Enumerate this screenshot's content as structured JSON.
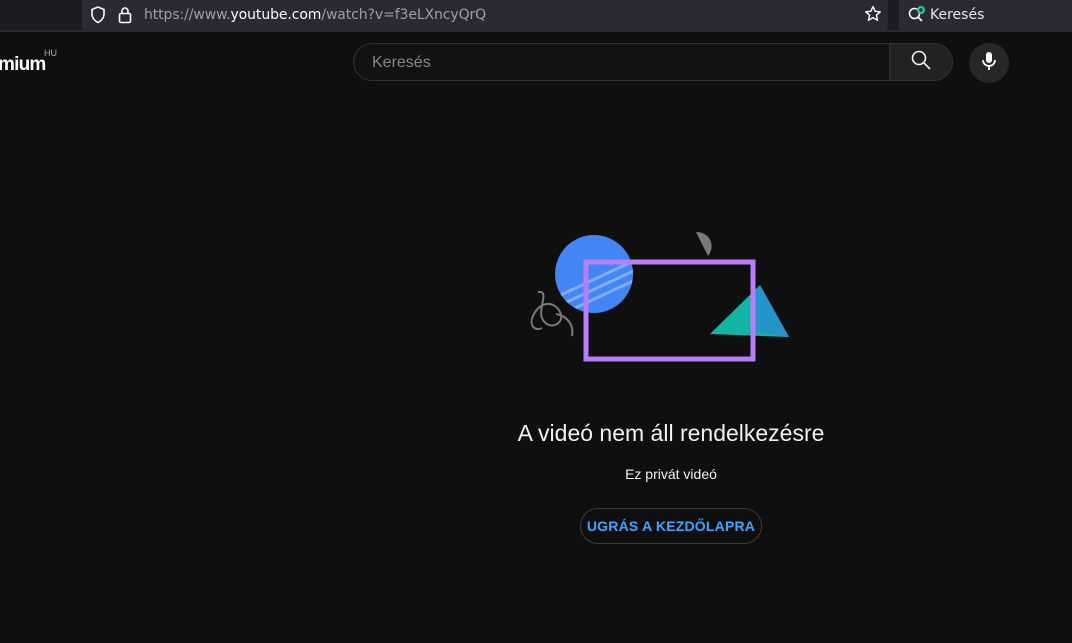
{
  "browser": {
    "url_prefix": "https://www.",
    "url_host": "youtube.com",
    "url_path": "/watch?v=f3eLXncyQrQ",
    "search_label": "Keresés"
  },
  "header": {
    "logo_text": "mium",
    "country_code": "HU",
    "search_placeholder": "Keresés"
  },
  "error": {
    "title": "A videó nem áll rendelkezésre",
    "subtitle": "Ez privát videó",
    "home_button_label": "UGRÁS A KEZDŐLAPRA"
  },
  "colors": {
    "background": "#0f0f0f",
    "accent_blue": "#3ea6ff",
    "illustration_purple": "#b67ff5",
    "illustration_blue": "#4285f4",
    "illustration_teal": "#12b5a5"
  }
}
